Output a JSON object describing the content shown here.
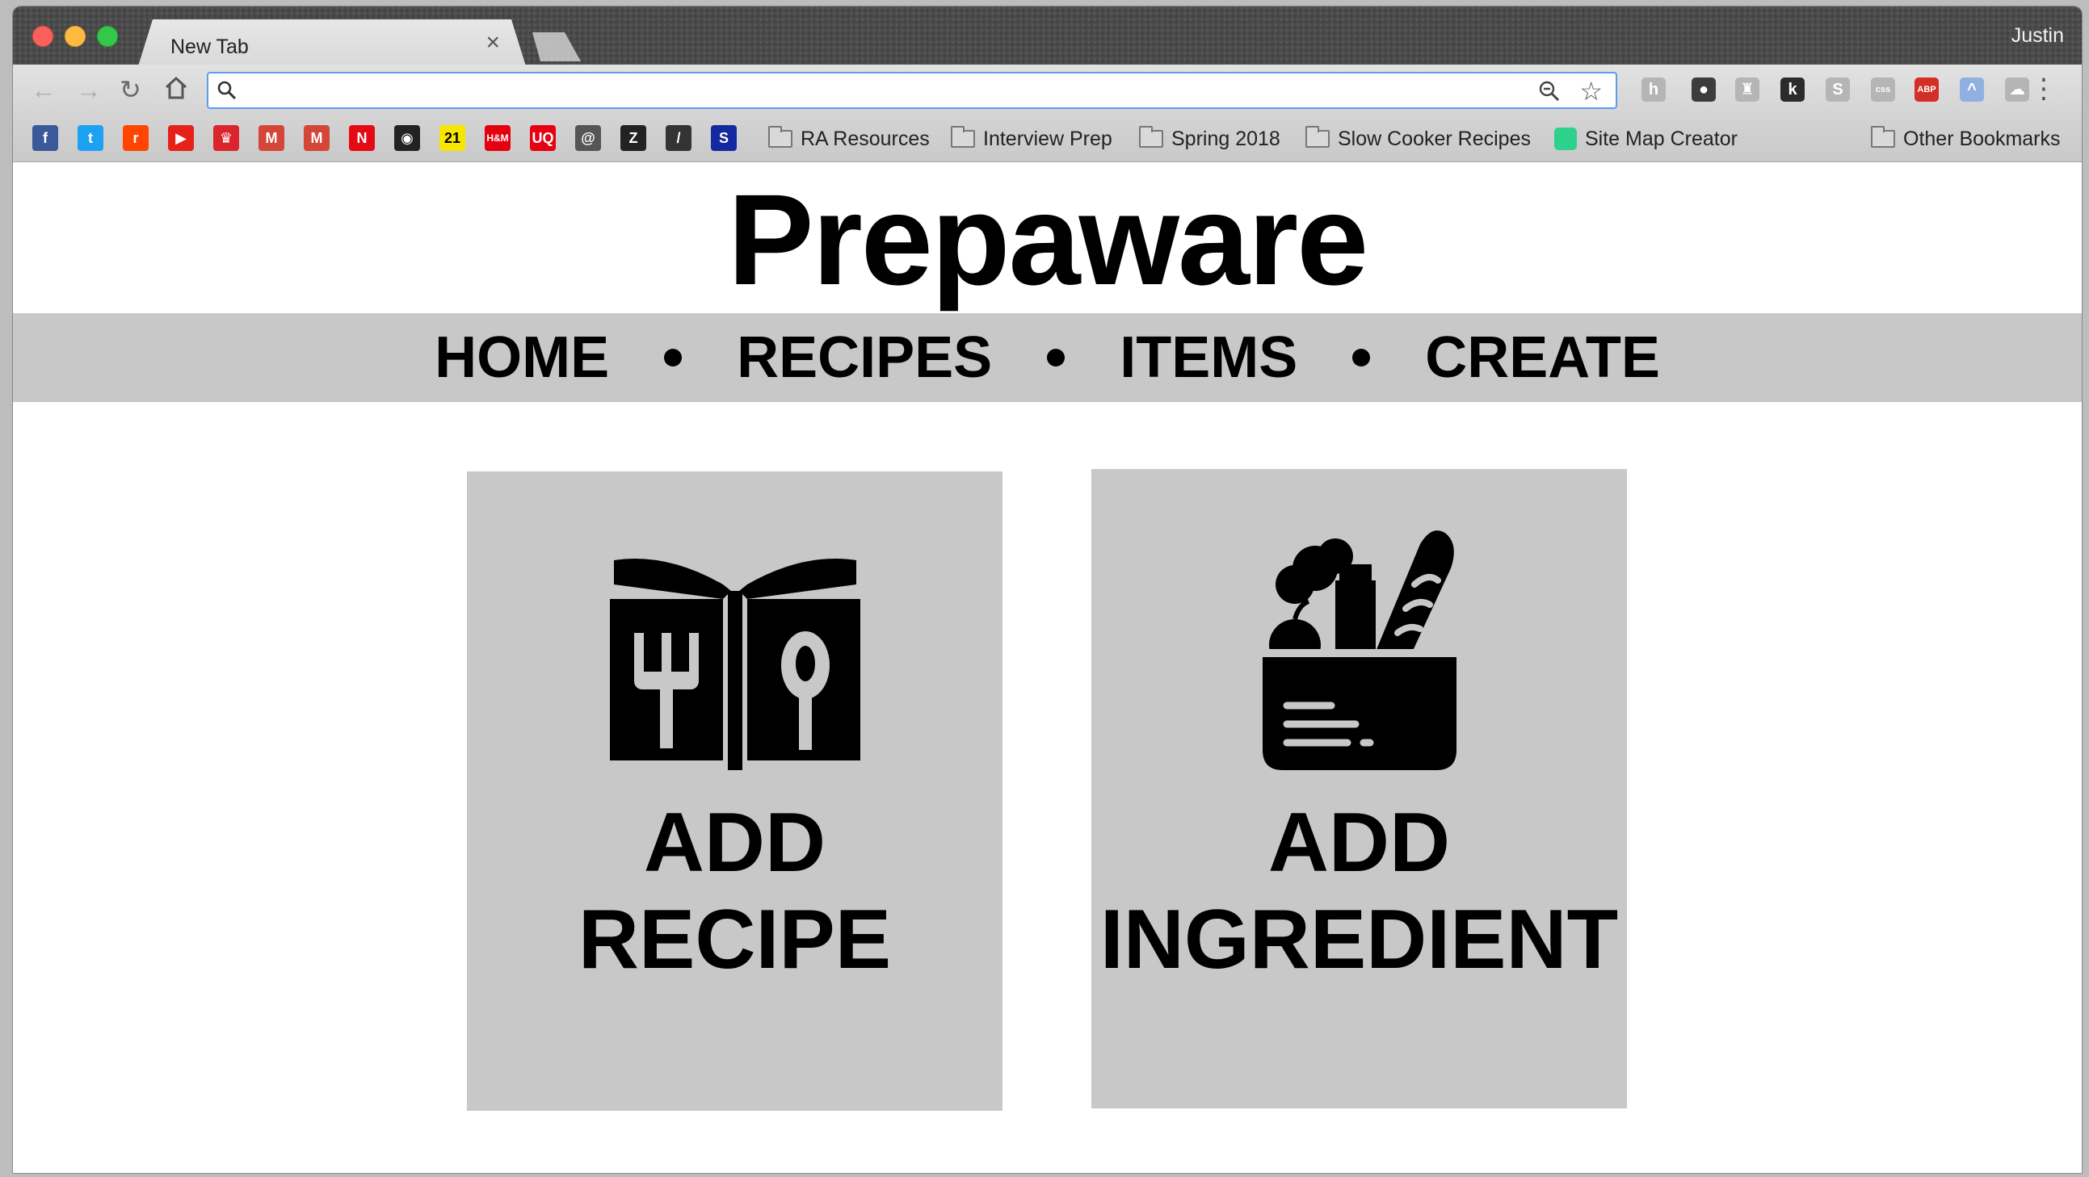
{
  "browser": {
    "tab_title": "New Tab",
    "tab_close": "×",
    "profile_name": "Justin",
    "address_value": "",
    "extensions": [
      {
        "icon": "h-icon",
        "text": "h",
        "color": "#b5b5b5"
      },
      {
        "icon": "green-dot-icon",
        "text": "●",
        "color": "#3c3c3c"
      },
      {
        "icon": "trophy-icon",
        "text": "♜",
        "color": "#b5b5b5"
      },
      {
        "icon": "k-icon",
        "text": "k",
        "color": "#2b2b2b"
      },
      {
        "icon": "s-icon",
        "text": "S",
        "color": "#b5b5b5"
      },
      {
        "icon": "css-icon",
        "text": "css",
        "color": "#b5b5b5"
      },
      {
        "icon": "adblock-icon",
        "text": "ABP",
        "color": "#d22f27"
      },
      {
        "icon": "rainbow-icon",
        "text": "^",
        "color": "#8fb0e0"
      },
      {
        "icon": "cloud-icon",
        "text": "☁",
        "color": "#b5b5b5"
      }
    ],
    "bookmark_favicons": [
      {
        "icon": "facebook-icon",
        "text": "f",
        "color": "#3b5998"
      },
      {
        "icon": "twitter-icon",
        "text": "t",
        "color": "#1da1f2"
      },
      {
        "icon": "reddit-icon",
        "text": "r",
        "color": "#ff4500"
      },
      {
        "icon": "youtube-icon",
        "text": "▶",
        "color": "#e62117"
      },
      {
        "icon": "crown-icon",
        "text": "♛",
        "color": "#d9252b"
      },
      {
        "icon": "gmail-icon",
        "text": "M",
        "color": "#d44638"
      },
      {
        "icon": "gmail-icon-2",
        "text": "M",
        "color": "#d44638"
      },
      {
        "icon": "netflix-icon",
        "text": "N",
        "color": "#e50914"
      },
      {
        "icon": "circle-icon",
        "text": "◉",
        "color": "#222222"
      },
      {
        "icon": "forever21-icon",
        "text": "21",
        "color": "#f7e600"
      },
      {
        "icon": "hm-icon",
        "text": "H&M",
        "color": "#e50010"
      },
      {
        "icon": "uniqlo-icon",
        "text": "UQ",
        "color": "#e60012"
      },
      {
        "icon": "at-icon",
        "text": "@",
        "color": "#555555"
      },
      {
        "icon": "zara-icon",
        "text": "Z",
        "color": "#222222"
      },
      {
        "icon": "slash-icon",
        "text": "/",
        "color": "#333333"
      },
      {
        "icon": "samsung-icon",
        "text": "S",
        "color": "#1428a0"
      }
    ],
    "bookmark_folders": [
      "RA Resources",
      "Interview Prep",
      "Spring 2018",
      "Slow Cooker Recipes"
    ],
    "bookmark_link": "Site Map Creator",
    "other_bookmarks": "Other Bookmarks"
  },
  "site": {
    "title": "Prepaware",
    "nav": [
      "HOME",
      "RECIPES",
      "ITEMS",
      "CREATE"
    ],
    "cards": {
      "recipe": {
        "line1": "ADD",
        "line2": "RECIPE",
        "icon": "recipe-book-icon"
      },
      "ingredient": {
        "line1": "ADD",
        "line2": "INGREDIENT",
        "icon": "grocery-bag-icon"
      }
    }
  }
}
